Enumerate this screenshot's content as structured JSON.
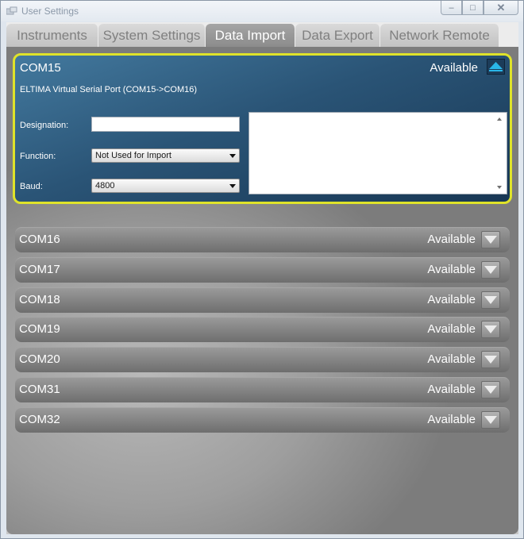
{
  "window": {
    "title": "User Settings",
    "controls": {
      "minimize": "–",
      "maximize": "□",
      "close": "✕"
    }
  },
  "tabs": [
    {
      "label": "Instruments",
      "active": false
    },
    {
      "label": "System Settings",
      "active": false
    },
    {
      "label": "Data Import",
      "active": true
    },
    {
      "label": "Data Export",
      "active": false
    },
    {
      "label": "Network Remote",
      "active": false
    }
  ],
  "expanded_port": {
    "name": "COM15",
    "status": "Available",
    "description": "ELTIMA Virtual Serial Port (COM15->COM16)",
    "designation_label": "Designation:",
    "designation_value": "",
    "function_label": "Function:",
    "function_value": "Not Used for Import",
    "baud_label": "Baud:",
    "baud_value": "4800",
    "log_text": ""
  },
  "ports": [
    {
      "name": "COM16",
      "status": "Available"
    },
    {
      "name": "COM17",
      "status": "Available"
    },
    {
      "name": "COM18",
      "status": "Available"
    },
    {
      "name": "COM19",
      "status": "Available"
    },
    {
      "name": "COM20",
      "status": "Available"
    },
    {
      "name": "COM31",
      "status": "Available"
    },
    {
      "name": "COM32",
      "status": "Available"
    }
  ],
  "icons": {
    "app": "app-icon",
    "collapse": "chevron-up-icon",
    "expand": "chevron-down-icon"
  },
  "colors": {
    "expanded_highlight": "#dfe32a",
    "expanded_background": "#2a5476",
    "collapse_arrow": "#29b6e8",
    "active_tab": "#9a9a9a"
  }
}
